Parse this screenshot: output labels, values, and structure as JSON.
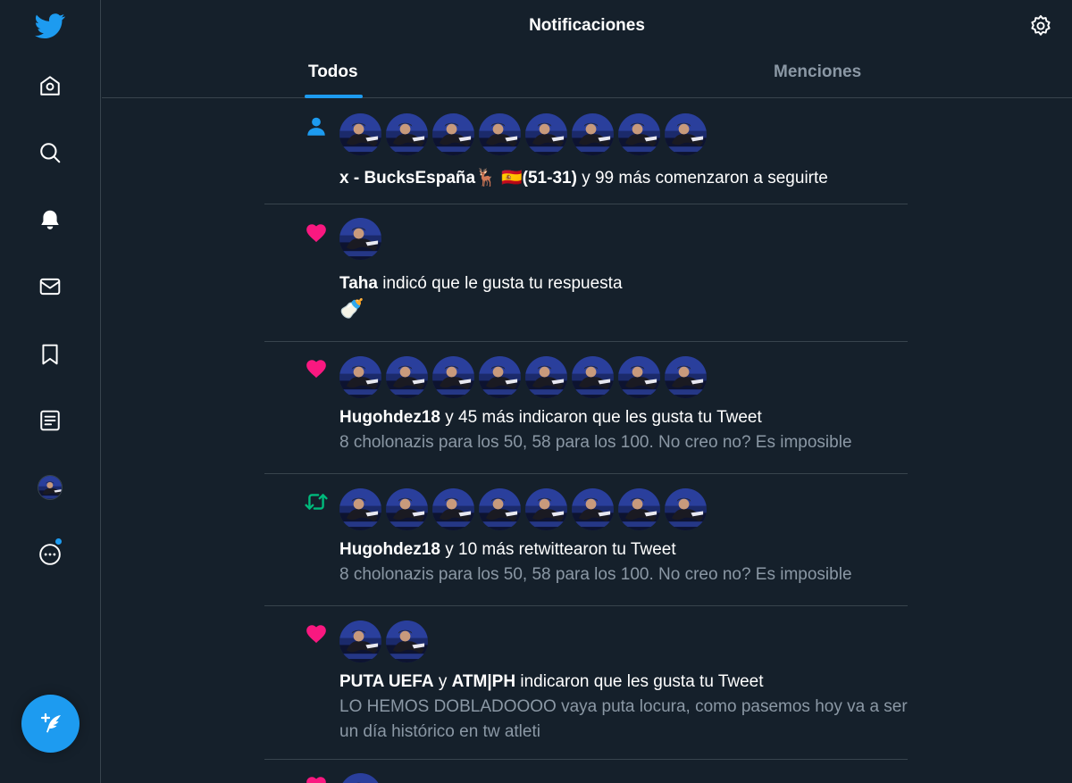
{
  "header": {
    "title": "Notificaciones"
  },
  "tabs": [
    {
      "label": "Todos",
      "active": true
    },
    {
      "label": "Menciones",
      "active": false
    }
  ],
  "sidebar": {
    "items": [
      {
        "icon": "twitter-logo-icon"
      },
      {
        "icon": "home-icon"
      },
      {
        "icon": "search-icon"
      },
      {
        "icon": "bell-icon"
      },
      {
        "icon": "mail-icon"
      },
      {
        "icon": "bookmark-icon"
      },
      {
        "icon": "lists-icon"
      },
      {
        "icon": "profile-avatar"
      },
      {
        "icon": "more-icon"
      }
    ],
    "compose_icon": "compose-tweet-icon"
  },
  "colors": {
    "accent": "#1d9bf0",
    "like": "#f91880",
    "retweet": "#00ba7c",
    "background": "#15202b",
    "muted": "#8b98a5"
  },
  "notifications": [
    {
      "type": "follow",
      "icon": "person-icon",
      "avatars": 8,
      "actor": "x - BucksEspaña🦌 🇪🇸(51-31)",
      "message": " y 99 más comenzaron a seguirte"
    },
    {
      "type": "like",
      "icon": "heart-icon",
      "avatars": 1,
      "actor": "Taha",
      "message": " indicó que le gusta tu respuesta",
      "content": "🍼"
    },
    {
      "type": "like",
      "icon": "heart-icon",
      "avatars": 8,
      "actor": "Hugohdez18",
      "message": " y 45 más indicaron que les gusta tu Tweet",
      "content": "8 cholonazis para los 50, 58 para los 100. No creo no? Es imposible"
    },
    {
      "type": "retweet",
      "icon": "retweet-icon",
      "avatars": 8,
      "actor": "Hugohdez18",
      "message": " y 10 más retwittearon tu Tweet",
      "content": "8 cholonazis para los 50, 58 para los 100. No creo no? Es imposible"
    },
    {
      "type": "like",
      "icon": "heart-icon",
      "avatars": 2,
      "actor": "PUTA UEFA",
      "connector": " y ",
      "actor2": "ATM|PH",
      "message": " indicaron que les gusta tu Tweet",
      "content": "LO HEMOS DOBLADOOOO vaya puta locura, como pasemos hoy va a ser un día histórico en tw atleti"
    },
    {
      "type": "like",
      "icon": "heart-icon",
      "avatars": 1
    }
  ]
}
